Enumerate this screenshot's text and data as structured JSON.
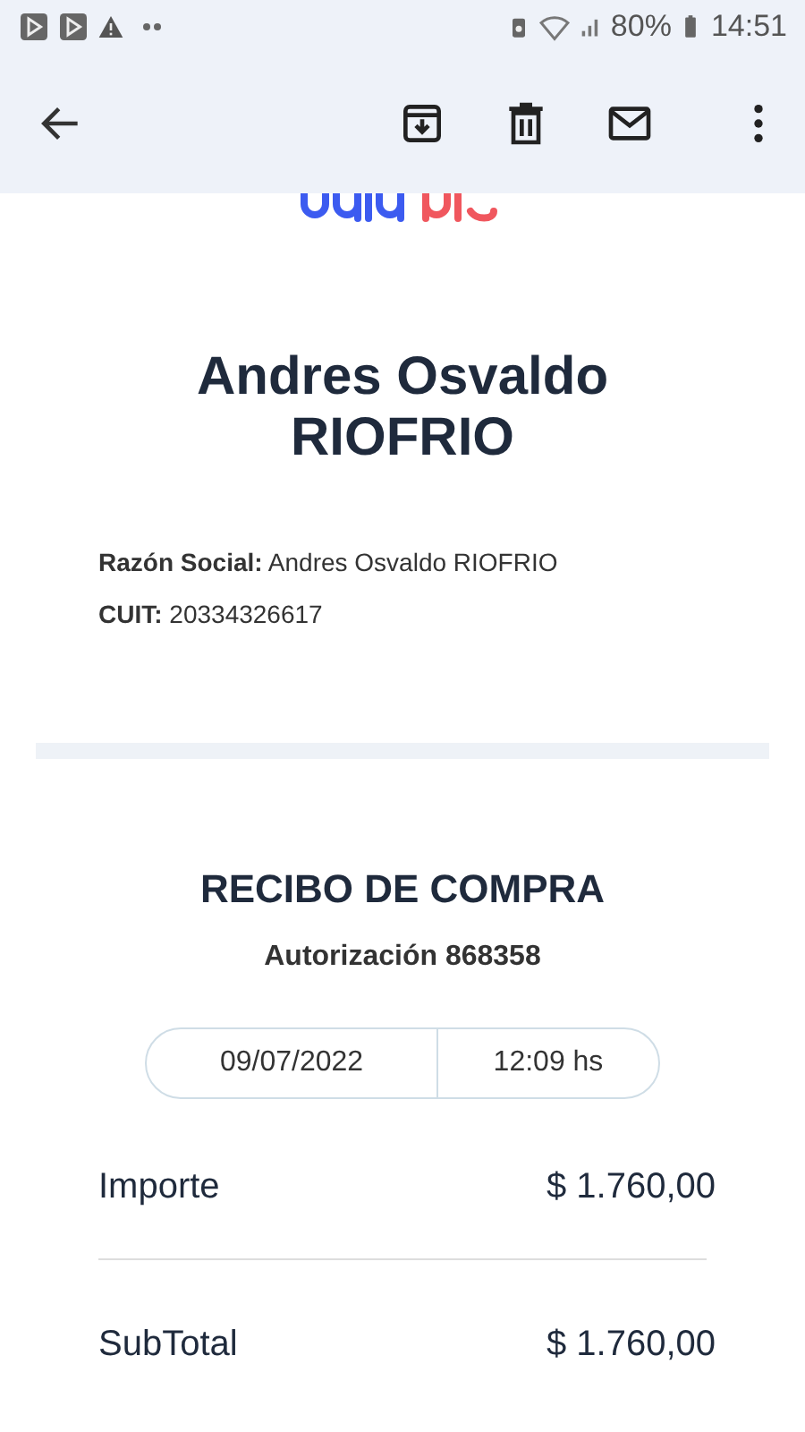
{
  "status_bar": {
    "battery": "80%",
    "time": "14:51"
  },
  "app_bar": {
    "actions": [
      {
        "kind": "archive"
      },
      {
        "kind": "delete"
      },
      {
        "kind": "mail"
      },
      {
        "kind": "more"
      }
    ]
  },
  "header": {
    "name": "Andres Osvaldo RIOFRIO",
    "fields": [
      {
        "label": "Razón Social:",
        "value": "Andres Osvaldo RIOFRIO"
      },
      {
        "label": "CUIT:",
        "value": "20334326617"
      }
    ]
  },
  "receipt": {
    "title": "RECIBO DE COMPRA",
    "authorization": "Autorización 868358",
    "date": "09/07/2022",
    "time": "12:09 hs",
    "rows": [
      {
        "label": "Importe",
        "amount": "$ 1.760,00"
      },
      {
        "label": "SubTotal",
        "amount": "$ 1.760,00"
      }
    ]
  }
}
